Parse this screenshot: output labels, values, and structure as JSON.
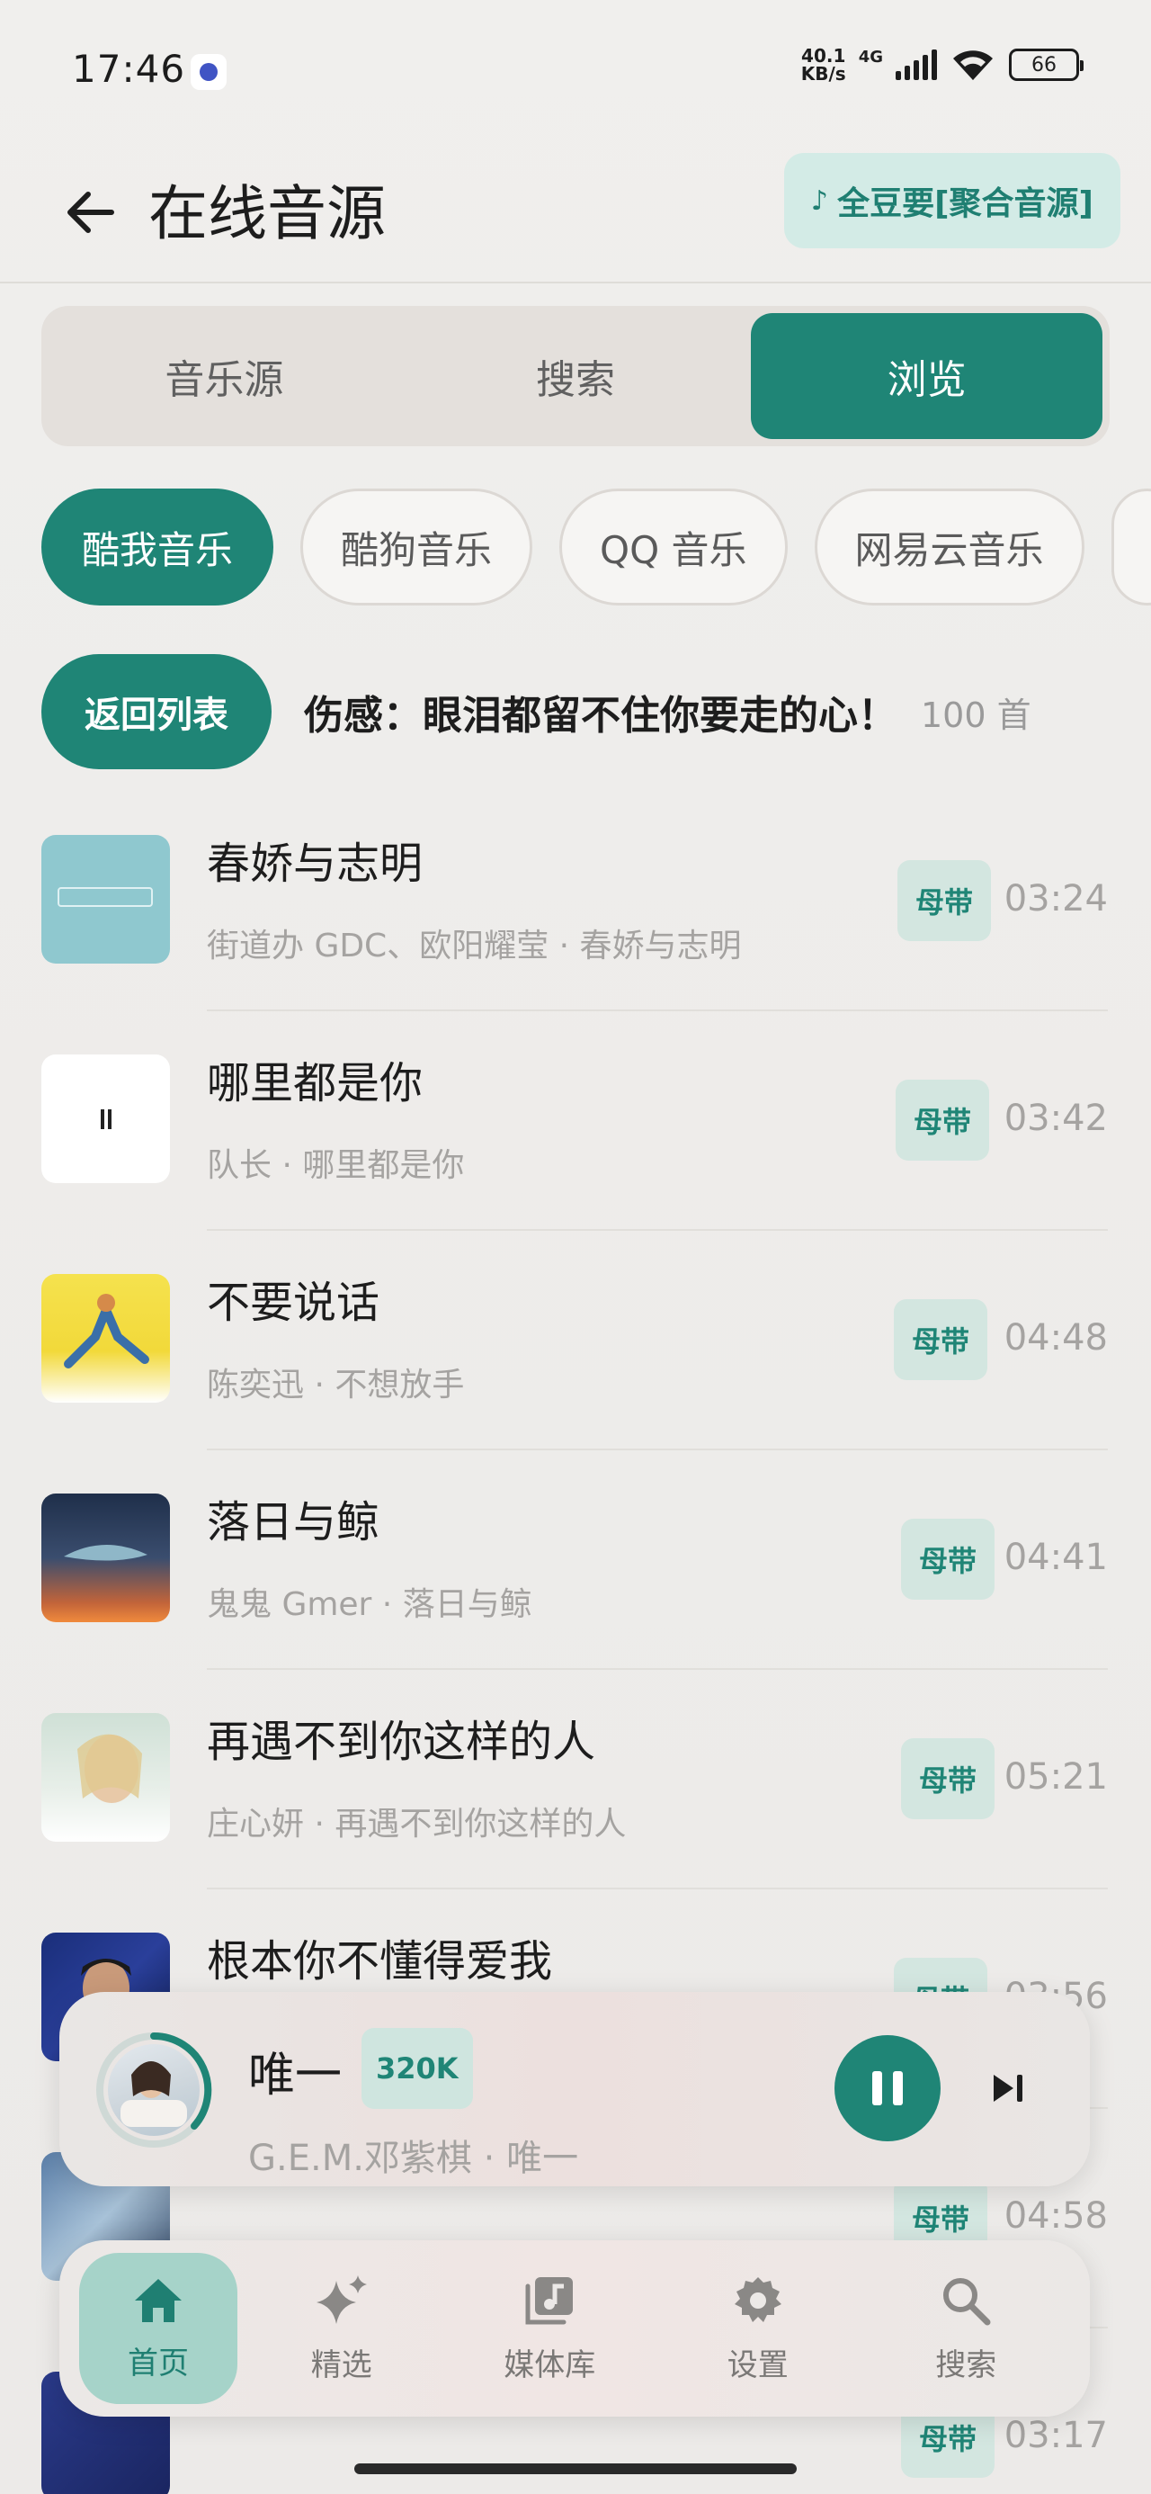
{
  "status_bar": {
    "time": "17:46",
    "speed_value": "40.1",
    "speed_unit": "KB/s",
    "network": "4G",
    "battery": "66"
  },
  "header": {
    "title": "在线音源",
    "source_label": "全豆要[聚合音源]"
  },
  "tabs": [
    {
      "label": "音乐源",
      "active": false
    },
    {
      "label": "搜索",
      "active": false
    },
    {
      "label": "浏览",
      "active": true
    }
  ],
  "sources": [
    {
      "label": "酷我音乐",
      "active": true
    },
    {
      "label": "酷狗音乐",
      "active": false
    },
    {
      "label": "QQ 音乐",
      "active": false
    },
    {
      "label": "网易云音乐",
      "active": false
    }
  ],
  "playlist": {
    "back_label": "返回列表",
    "title": "伤感：眼泪都留不住你要走的心！",
    "count": "100 首"
  },
  "songs": [
    {
      "title": "春娇与志明",
      "subtitle": "街道办 GDC、欧阳耀莹 · 春娇与志明",
      "quality": "母带",
      "duration": "03:24"
    },
    {
      "title": "哪里都是你",
      "subtitle": "队长 · 哪里都是你",
      "quality": "母带",
      "duration": "03:42"
    },
    {
      "title": "不要说话",
      "subtitle": "陈奕迅 · 不想放手",
      "quality": "母带",
      "duration": "04:48"
    },
    {
      "title": "落日与鲸",
      "subtitle": "鬼鬼 Gmer · 落日与鲸",
      "quality": "母带",
      "duration": "04:41"
    },
    {
      "title": "再遇不到你这样的人",
      "subtitle": "庄心妍 · 再遇不到你这样的人",
      "quality": "母带",
      "duration": "05:21"
    },
    {
      "title": "根本你不懂得爱我",
      "subtitle": "",
      "quality": "母带",
      "duration": "03:56"
    },
    {
      "title": "",
      "subtitle": "",
      "quality": "母带",
      "duration": "04:58"
    },
    {
      "title": "",
      "subtitle": "",
      "quality": "母带",
      "duration": "03:17"
    }
  ],
  "mini_player": {
    "title": "唯一",
    "badge": "320K",
    "subtitle": "G.E.M.邓紫棋 · 唯一"
  },
  "nav": [
    {
      "label": "首页",
      "icon": "home-icon",
      "active": true
    },
    {
      "label": "精选",
      "icon": "sparkle-icon",
      "active": false
    },
    {
      "label": "媒体库",
      "icon": "library-icon",
      "active": false
    },
    {
      "label": "设置",
      "icon": "gear-icon",
      "active": false
    },
    {
      "label": "搜索",
      "icon": "search-icon",
      "active": false
    }
  ],
  "colors": {
    "accent": "#1f8576",
    "accent_light": "#d3ebe6",
    "background": "#eeecea"
  }
}
